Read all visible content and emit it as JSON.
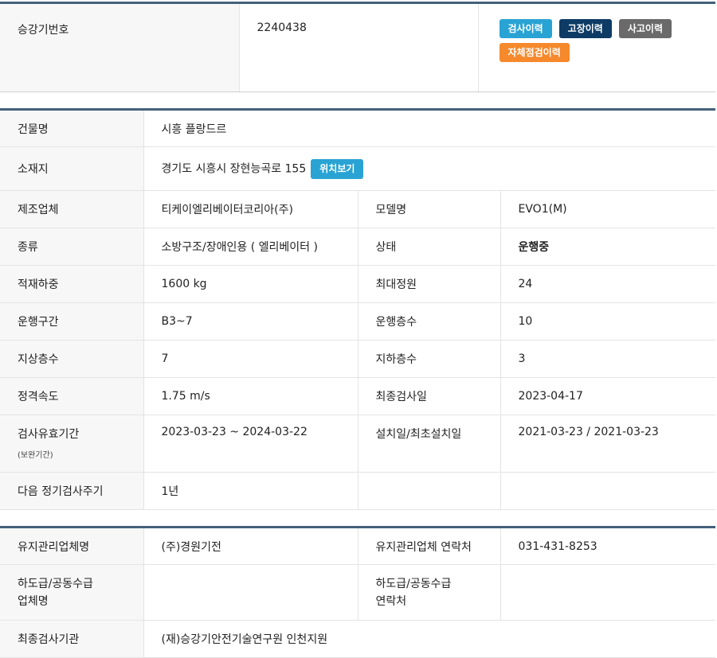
{
  "header": {
    "label": "승강기번호",
    "value": "2240438",
    "buttons": [
      "검사이력",
      "고장이력",
      "사고이력",
      "자체점검이력"
    ]
  },
  "info": {
    "building_label": "건물명",
    "building_value": "시흥 플랑드르",
    "address_label": "소재지",
    "address_value": "경기도 시흥시 장현능곡로 155",
    "location_button": "위치보기",
    "rows": [
      {
        "l1": "제조업체",
        "v1": "티케이엘리베이터코리아(주)",
        "l2": "모델명",
        "v2": "EVO1(M)"
      },
      {
        "l1": "종류",
        "v1": "소방구조/장애인용 ( 엘리베이터 )",
        "l2": "상태",
        "v2": "운행중"
      },
      {
        "l1": "적재하중",
        "v1": "1600 kg",
        "l2": "최대정원",
        "v2": "24"
      },
      {
        "l1": "운행구간",
        "v1": "B3~7",
        "l2": "운행층수",
        "v2": "10"
      },
      {
        "l1": "지상층수",
        "v1": "7",
        "l2": "지하층수",
        "v2": "3"
      },
      {
        "l1": "정격속도",
        "v1": "1.75 m/s",
        "l2": "최종검사일",
        "v2": "2023-04-17"
      },
      {
        "l1": "검사유효기간",
        "l1_sub": "(보완기간)",
        "v1": "2023-03-23 ~ 2024-03-22",
        "l2": "설치일/최초설치일",
        "v2": "2021-03-23 / 2021-03-23"
      },
      {
        "l1": "다음 정기검사주기",
        "v1": "1년",
        "l2": "",
        "v2": ""
      }
    ]
  },
  "maintenance": {
    "company_label": "유지관리업체명",
    "company_value": "(주)경원기전",
    "contact_label": "유지관리업체 연락처",
    "contact_value": "031-431-8253",
    "sub_label_1": "하도급/공동수급",
    "sub_label_2": "업체명",
    "sub_contact_label_1": "하도급/공동수급",
    "sub_contact_label_2": "연락처",
    "agency_label": "최종검사기관",
    "agency_value": "(재)승강기안전기술연구원 인천지원"
  }
}
